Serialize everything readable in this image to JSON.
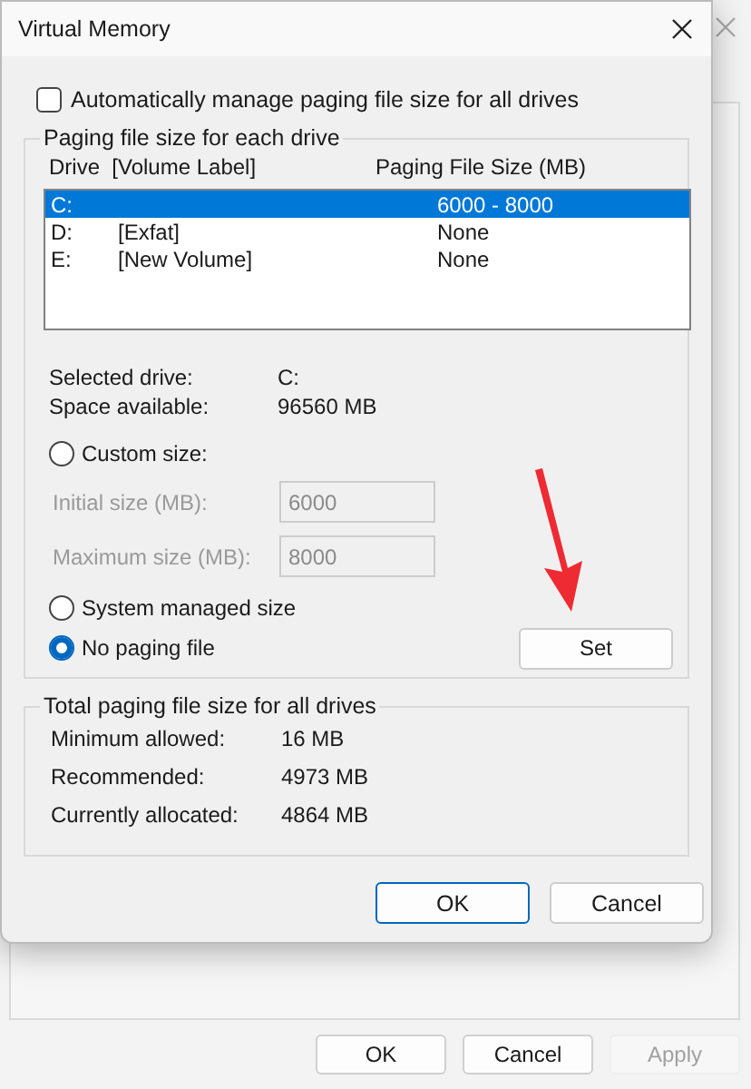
{
  "background_window": {
    "buttons": [
      {
        "label": "OK",
        "disabled": false
      },
      {
        "label": "Cancel",
        "disabled": false
      },
      {
        "label": "Apply",
        "disabled": true
      }
    ]
  },
  "dialog": {
    "title": "Virtual Memory",
    "auto_manage": {
      "label": "Automatically manage paging file size for all drives",
      "checked": false
    },
    "drives_group": {
      "title": "Paging file size for each drive",
      "columns": [
        "Drive  [Volume Label]",
        "Paging File Size (MB)"
      ],
      "rows": [
        {
          "drive": "C:",
          "label": "",
          "size": "6000 - 8000",
          "selected": true
        },
        {
          "drive": "D:",
          "label": "[Exfat]",
          "size": "None",
          "selected": false
        },
        {
          "drive": "E:",
          "label": "[New Volume]",
          "size": "None",
          "selected": false
        }
      ],
      "info": [
        {
          "label": "Selected drive:",
          "value": "C:"
        },
        {
          "label": "Space available:",
          "value": "96560 MB"
        }
      ],
      "size_options": [
        {
          "label": "Custom size:",
          "selected": false,
          "fields": [
            {
              "label": "Initial size (MB):",
              "value": "6000",
              "disabled": true
            },
            {
              "label": "Maximum size (MB):",
              "value": "8000",
              "disabled": true
            }
          ]
        },
        {
          "label": "System managed size",
          "selected": false
        },
        {
          "label": "No paging file",
          "selected": true
        }
      ],
      "set_button": "Set"
    },
    "totals_group": {
      "title": "Total paging file size for all drives",
      "rows": [
        {
          "label": "Minimum allowed:",
          "value": "16 MB"
        },
        {
          "label": "Recommended:",
          "value": "4973 MB"
        },
        {
          "label": "Currently allocated:",
          "value": "4864 MB"
        }
      ]
    },
    "buttons": [
      {
        "label": "OK",
        "default": true
      },
      {
        "label": "Cancel",
        "default": false
      }
    ]
  }
}
